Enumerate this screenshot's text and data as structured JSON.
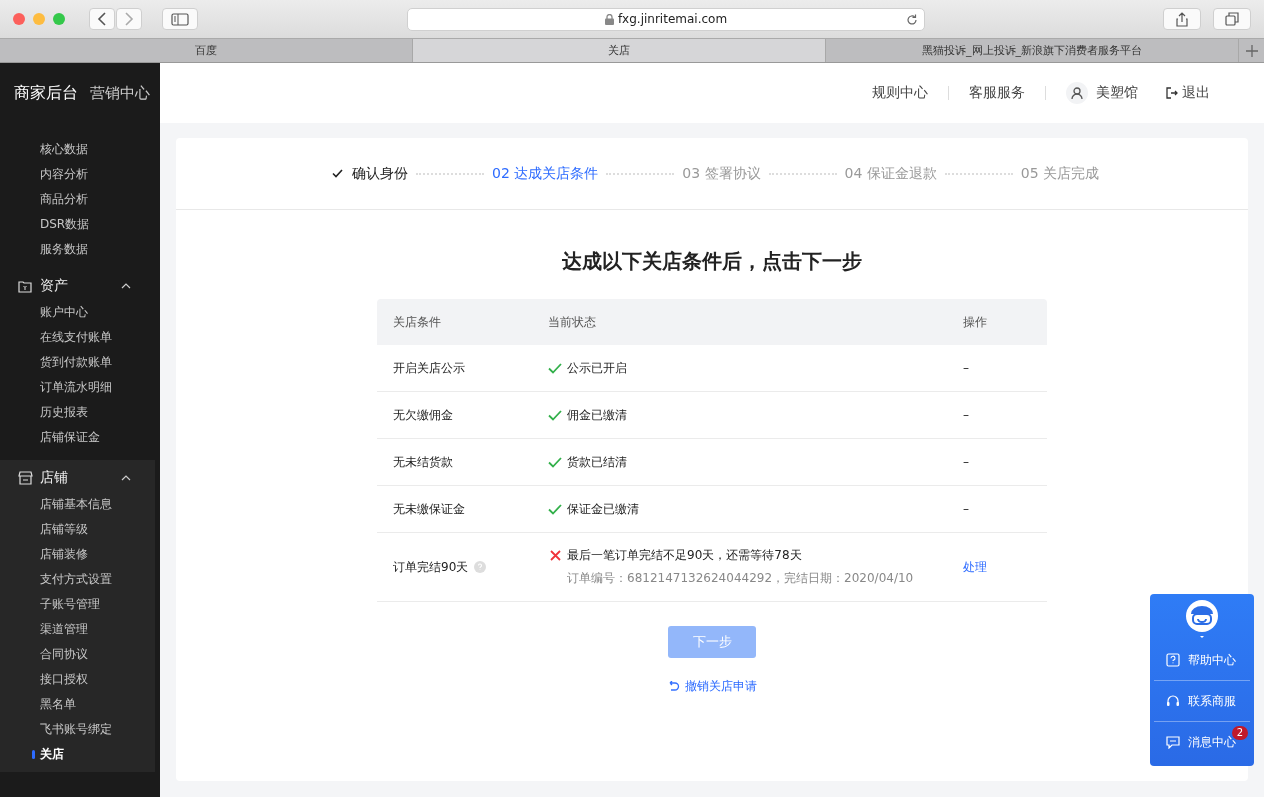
{
  "browser": {
    "url": "fxg.jinritemai.com",
    "tabs": [
      {
        "label": "百度",
        "selected": false
      },
      {
        "label": "关店",
        "selected": true
      },
      {
        "label": "黑猫投诉_网上投诉_新浪旗下消费者服务平台",
        "selected": false
      }
    ]
  },
  "sidebar": {
    "tabs": [
      {
        "label": "商家后台",
        "selected": true
      },
      {
        "label": "营销中心",
        "selected": false
      }
    ],
    "groups": [
      {
        "items": [
          {
            "label": "核心数据",
            "selected": false
          },
          {
            "label": "内容分析",
            "selected": false
          },
          {
            "label": "商品分析",
            "selected": false
          },
          {
            "label": "DSR数据",
            "selected": false
          },
          {
            "label": "服务数据",
            "selected": false
          }
        ]
      },
      {
        "label": "资产",
        "expanded": true,
        "items": [
          {
            "label": "账户中心",
            "selected": false
          },
          {
            "label": "在线支付账单",
            "selected": false
          },
          {
            "label": "货到付款账单",
            "selected": false
          },
          {
            "label": "订单流水明细",
            "selected": false
          },
          {
            "label": "历史报表",
            "selected": false
          },
          {
            "label": "店铺保证金",
            "selected": false
          }
        ]
      },
      {
        "label": "店铺",
        "expanded": true,
        "items": [
          {
            "label": "店铺基本信息",
            "selected": false
          },
          {
            "label": "店铺等级",
            "selected": false
          },
          {
            "label": "店铺装修",
            "selected": false
          },
          {
            "label": "支付方式设置",
            "selected": false
          },
          {
            "label": "子账号管理",
            "selected": false
          },
          {
            "label": "渠道管理",
            "selected": false
          },
          {
            "label": "合同协议",
            "selected": false
          },
          {
            "label": "接口授权",
            "selected": false
          },
          {
            "label": "黑名单",
            "selected": false
          },
          {
            "label": "飞书账号绑定",
            "selected": false
          },
          {
            "label": "关店",
            "selected": true
          }
        ]
      }
    ]
  },
  "header_nav": [
    {
      "label": "规则中心",
      "kind": "link"
    },
    {
      "label": "客服服务",
      "kind": "link"
    },
    {
      "label": "美塑馆",
      "kind": "user"
    },
    {
      "label": "退出",
      "kind": "logout"
    }
  ],
  "steps": [
    {
      "label": "确认身份",
      "done": true,
      "selected": false
    },
    {
      "label": "02 达成关店条件",
      "done": false,
      "selected": true
    },
    {
      "label": "03 签署协议",
      "done": false,
      "selected": false
    },
    {
      "label": "04 保证金退款",
      "done": false,
      "selected": false
    },
    {
      "label": "05 关店完成",
      "done": false,
      "selected": false
    }
  ],
  "title": "达成以下关店条件后，点击下一步",
  "table": {
    "columns": [
      "关店条件",
      "当前状态",
      "操作"
    ],
    "rows": [
      {
        "condition": "开启关店公示",
        "met": true,
        "status": "公示已开启",
        "action": {
          "text": "–",
          "kind": "none"
        }
      },
      {
        "condition": "无欠缴佣金",
        "met": true,
        "status": "佣金已缴清",
        "action": {
          "text": "–",
          "kind": "none"
        }
      },
      {
        "condition": "无未结货款",
        "met": true,
        "status": "货款已结清",
        "action": {
          "text": "–",
          "kind": "none"
        }
      },
      {
        "condition": "无未缴保证金",
        "met": true,
        "status": "保证金已缴清",
        "action": {
          "text": "–",
          "kind": "none"
        }
      },
      {
        "condition": "订单完结90天",
        "help": true,
        "met": false,
        "status": "最后一笔订单完结不足90天，还需等待78天",
        "detail": "订单编号：6812147132624044292，完结日期：2020/04/10",
        "action": {
          "text": "处理",
          "kind": "link"
        }
      }
    ]
  },
  "next_button": {
    "label": "下一步",
    "disabled": true
  },
  "cancel_link": "撤销关店申请",
  "float_panel": {
    "items": [
      {
        "label": "帮助中心"
      },
      {
        "label": "联系商服"
      },
      {
        "label": "消息中心",
        "badge": "2"
      }
    ]
  }
}
